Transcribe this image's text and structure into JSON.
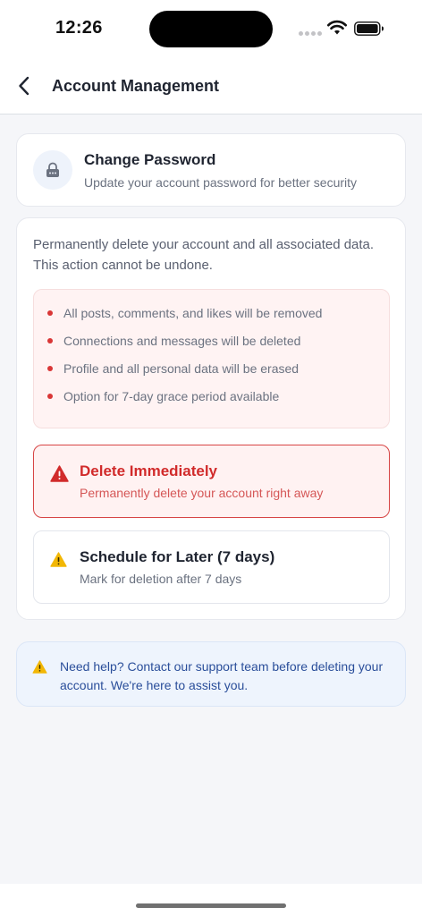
{
  "status_bar": {
    "time": "12:26",
    "icons": [
      "signal-dots-icon",
      "wifi-icon",
      "battery-icon"
    ]
  },
  "header": {
    "back_icon": "chevron-left-icon",
    "title": "Account Management"
  },
  "change_password": {
    "icon": "lock-icon",
    "title": "Change Password",
    "subtitle": "Update your account password for better security"
  },
  "delete_account": {
    "description": "Permanently delete your account and all associated data. This action cannot be undone.",
    "consequences": [
      "All posts, comments, and likes will be removed",
      "Connections and messages will be deleted",
      "Profile and all personal data will be erased",
      "Option for 7-day grace period available"
    ],
    "options": {
      "immediate": {
        "icon": "warning-triangle-icon",
        "title": "Delete Immediately",
        "subtitle": "Permanently delete your account right away"
      },
      "scheduled": {
        "icon": "warning-triangle-icon",
        "title": "Schedule for Later (7 days)",
        "subtitle": "Mark for deletion after 7 days"
      }
    }
  },
  "help": {
    "icon": "warning-triangle-icon",
    "text": "Need help? Contact our support team before deleting your account. We're here to assist you."
  },
  "colors": {
    "danger": "#d12b2b",
    "danger_bg": "#fff2f2",
    "warning": "#f2b705",
    "info_text": "#2a4e9a",
    "info_bg": "#eef4fd",
    "background": "#f5f6f9"
  }
}
